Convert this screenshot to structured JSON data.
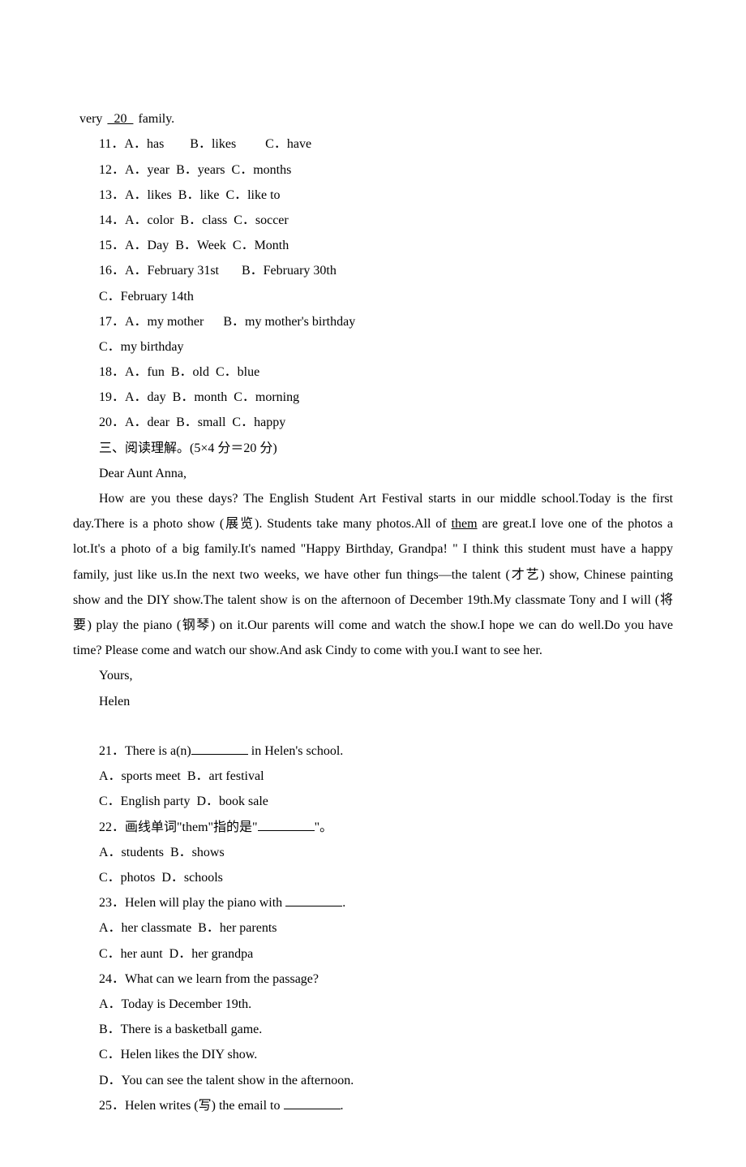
{
  "top_fragment": {
    "pre": "very ",
    "blank_num": "  20  ",
    "post": " family."
  },
  "cloze_options": [
    {
      "num": "11．A．has",
      "b": "B．likes",
      "c": "C．have",
      "gap1": "        ",
      "gap2": "         "
    },
    {
      "num": "12．A．year",
      "b": "B．years",
      "c": "C．months",
      "gap1": "  ",
      "gap2": "  "
    },
    {
      "num": "13．A．likes",
      "b": "B．like",
      "c": "C．like to",
      "gap1": "  ",
      "gap2": "  "
    },
    {
      "num": "14．A．color",
      "b": "B．class",
      "c": "C．soccer",
      "gap1": "  ",
      "gap2": "  "
    },
    {
      "num": "15．A．Day",
      "b": "B．Week",
      "c": "C．Month",
      "gap1": "  ",
      "gap2": "  "
    },
    {
      "num": "16．A．February 31st",
      "b": "B．February 30th",
      "c": "",
      "gap1": "       ",
      "gap2": ""
    },
    {
      "num": "C．February 14th",
      "b": "",
      "c": "",
      "gap1": "",
      "gap2": ""
    },
    {
      "num": "17．A．my mother",
      "b": "B．my mother's birthday",
      "c": "",
      "gap1": "      ",
      "gap2": ""
    },
    {
      "num": "C．my birthday",
      "b": "",
      "c": "",
      "gap1": "",
      "gap2": ""
    },
    {
      "num": "18．A．fun",
      "b": "B．old",
      "c": "C．blue",
      "gap1": "  ",
      "gap2": "  "
    },
    {
      "num": "19．A．day",
      "b": "B．month",
      "c": "C．morning",
      "gap1": "  ",
      "gap2": "  "
    },
    {
      "num": "20．A．dear",
      "b": "B．small",
      "c": "C．happy",
      "gap1": "  ",
      "gap2": "  "
    }
  ],
  "section3_title": "三、阅读理解。(5×4 分＝20 分)",
  "letter": {
    "greeting": "Dear Aunt Anna,",
    "p1_pre": "How are you these days? The English Student Art Festival starts in our middle school.Today is the first day.There is a photo show (展览). Students take many photos.All of ",
    "p1_under": "them",
    "p1_post": " are great.I love one of the photos a lot.It's a photo of a big family.It's named \"Happy Birthday, Grandpa! \" I think this student must have a happy family, just like us.In the next two weeks, we have other fun things—the talent (才艺) show, Chinese painting show and the DIY show.The talent show is on the afternoon of December 19th.My classmate Tony and I will (将要)  play the piano (钢琴) on it.Our parents will come and watch the show.I hope we can do well.Do you have time? Please come and watch our show.And ask Cindy to come with you.I want to see her.",
    "closing1": "Yours,",
    "closing2": "Helen"
  },
  "reading_questions": [
    {
      "stem_pre": "21．There is a(n)",
      "stem_post": " in Helen's school.",
      "has_blank": true,
      "opts": [
        "A．sports meet  B．art festival",
        "C．English party  D．book sale"
      ]
    },
    {
      "stem_pre": "22．画线单词\"them\"指的是\"",
      "stem_post": "\"。",
      "has_blank": true,
      "opts": [
        "A．students  B．shows",
        "C．photos  D．schools"
      ]
    },
    {
      "stem_pre": "23．Helen will play the piano with ",
      "stem_post": ".",
      "has_blank": true,
      "opts": [
        "A．her classmate  B．her parents",
        "C．her aunt  D．her grandpa"
      ]
    },
    {
      "stem_pre": "24．What can we learn from the passage?",
      "stem_post": "",
      "has_blank": false,
      "opts": [
        "A．Today is December 19th.",
        "B．There is a basketball game.",
        "C．Helen likes the DIY show.",
        "D．You can see the talent show in the afternoon."
      ]
    },
    {
      "stem_pre": "25．Helen writes (写) the e­mail to ",
      "stem_post": ".",
      "has_blank": true,
      "opts": []
    }
  ]
}
